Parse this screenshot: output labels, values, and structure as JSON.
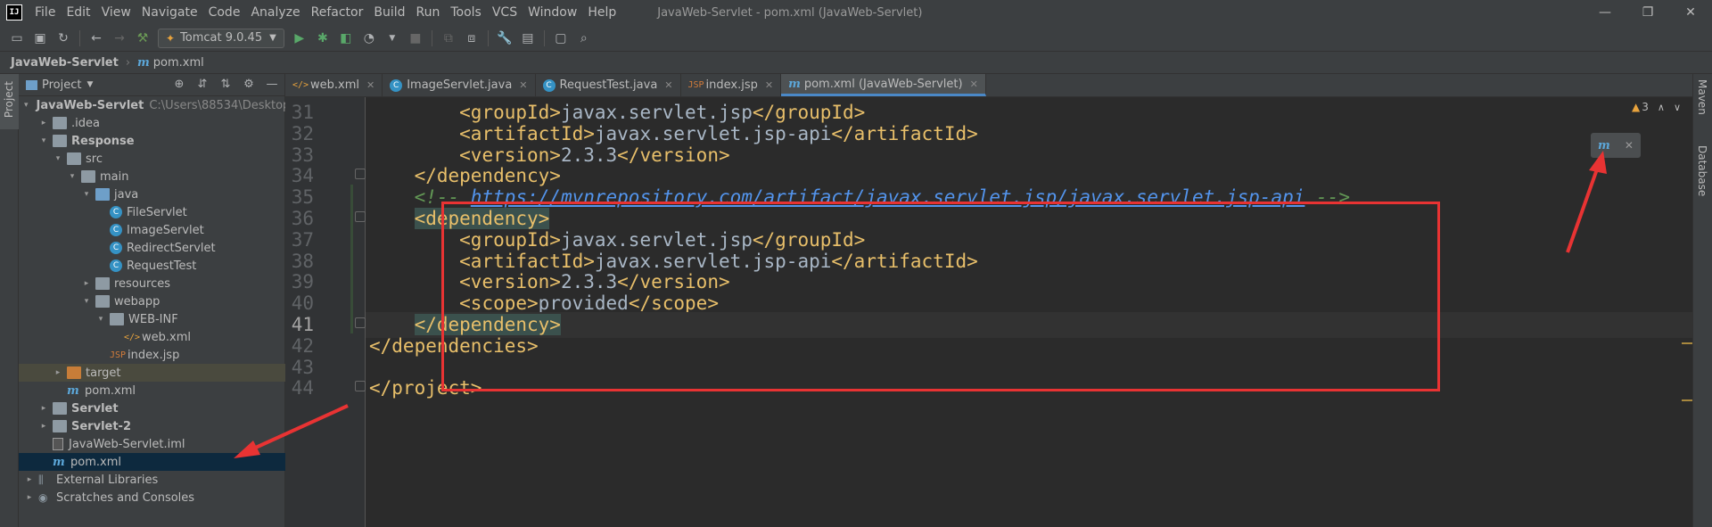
{
  "menubar": {
    "logo": "IJ",
    "items": [
      "File",
      "Edit",
      "View",
      "Navigate",
      "Code",
      "Analyze",
      "Refactor",
      "Build",
      "Run",
      "Tools",
      "VCS",
      "Window",
      "Help"
    ],
    "window_title": "JavaWeb-Servlet - pom.xml (JavaWeb-Servlet)",
    "controls": [
      "—",
      "❐",
      "✕"
    ]
  },
  "toolbar": {
    "run_config": "Tomcat 9.0.45"
  },
  "breadcrumb": {
    "root": "JavaWeb-Servlet",
    "file": "pom.xml",
    "file_icon": "m"
  },
  "left_strip": {
    "project_label": "Project"
  },
  "project_panel": {
    "title": "Project",
    "tree": [
      {
        "label": "JavaWeb-Servlet",
        "path": "C:\\Users\\88534\\Desktop\\",
        "icon": "folder",
        "indent": 0,
        "expand": "▾",
        "bold": true
      },
      {
        "label": ".idea",
        "icon": "folder",
        "indent": 1,
        "expand": "▸"
      },
      {
        "label": "Response",
        "icon": "folder",
        "indent": 1,
        "expand": "▾",
        "bold": true
      },
      {
        "label": "src",
        "icon": "folder",
        "indent": 2,
        "expand": "▾"
      },
      {
        "label": "main",
        "icon": "folder",
        "indent": 3,
        "expand": "▾"
      },
      {
        "label": "java",
        "icon": "folder-blue",
        "indent": 4,
        "expand": "▾"
      },
      {
        "label": "FileServlet",
        "icon": "class",
        "indent": 5,
        "expand": ""
      },
      {
        "label": "ImageServlet",
        "icon": "class",
        "indent": 5,
        "expand": ""
      },
      {
        "label": "RedirectServlet",
        "icon": "class",
        "indent": 5,
        "expand": ""
      },
      {
        "label": "RequestTest",
        "icon": "class",
        "indent": 5,
        "expand": ""
      },
      {
        "label": "resources",
        "icon": "folder",
        "indent": 4,
        "expand": "▸"
      },
      {
        "label": "webapp",
        "icon": "folder",
        "indent": 4,
        "expand": "▾"
      },
      {
        "label": "WEB-INF",
        "icon": "folder",
        "indent": 5,
        "expand": "▾"
      },
      {
        "label": "web.xml",
        "icon": "xml",
        "indent": 6,
        "expand": ""
      },
      {
        "label": "index.jsp",
        "icon": "jsp",
        "indent": 5,
        "expand": ""
      },
      {
        "label": "target",
        "icon": "folder-orange",
        "indent": 2,
        "expand": "▸",
        "excluded": true
      },
      {
        "label": "pom.xml",
        "icon": "maven",
        "indent": 2,
        "expand": ""
      },
      {
        "label": "Servlet",
        "icon": "folder",
        "indent": 1,
        "expand": "▸",
        "bold": true
      },
      {
        "label": "Servlet-2",
        "icon": "folder",
        "indent": 1,
        "expand": "▸",
        "bold": true
      },
      {
        "label": "JavaWeb-Servlet.iml",
        "icon": "iml",
        "indent": 1,
        "expand": ""
      },
      {
        "label": "pom.xml",
        "icon": "maven",
        "indent": 1,
        "expand": "",
        "selected": true
      },
      {
        "label": "External Libraries",
        "icon": "lib",
        "indent": 0,
        "expand": "▸"
      },
      {
        "label": "Scratches and Consoles",
        "icon": "scratch",
        "indent": 0,
        "expand": "▸"
      }
    ]
  },
  "editor_tabs": [
    {
      "label": "web.xml",
      "icon": "xml"
    },
    {
      "label": "ImageServlet.java",
      "icon": "class"
    },
    {
      "label": "RequestTest.java",
      "icon": "class"
    },
    {
      "label": "index.jsp",
      "icon": "jsp"
    },
    {
      "label": "pom.xml (JavaWeb-Servlet)",
      "icon": "maven",
      "active": true
    }
  ],
  "editor": {
    "lines": [
      {
        "n": "31",
        "segs": [
          [
            "pad",
            "        "
          ],
          [
            "tag",
            "<groupId>"
          ],
          [
            "text",
            "javax.servlet.jsp"
          ],
          [
            "tag",
            "</groupId>"
          ]
        ]
      },
      {
        "n": "32",
        "segs": [
          [
            "pad",
            "        "
          ],
          [
            "tag",
            "<artifactId>"
          ],
          [
            "text",
            "javax.servlet.jsp-api"
          ],
          [
            "tag",
            "</artifactId>"
          ]
        ]
      },
      {
        "n": "33",
        "segs": [
          [
            "pad",
            "        "
          ],
          [
            "tag",
            "<version>"
          ],
          [
            "text",
            "2.3.3"
          ],
          [
            "tag",
            "</version>"
          ]
        ]
      },
      {
        "n": "34",
        "segs": [
          [
            "pad",
            "    "
          ],
          [
            "tag",
            "</dependency>"
          ]
        ]
      },
      {
        "n": "35",
        "segs": [
          [
            "pad",
            "    "
          ],
          [
            "comment",
            "<!-- "
          ],
          [
            "link",
            "https://mvnrepository.com/artifact/javax.servlet.jsp/javax.servlet.jsp-api"
          ],
          [
            "comment",
            " -->"
          ]
        ]
      },
      {
        "n": "36",
        "segs": [
          [
            "pad",
            "    "
          ],
          [
            "match",
            "<dependency>"
          ]
        ]
      },
      {
        "n": "37",
        "segs": [
          [
            "pad",
            "        "
          ],
          [
            "tag",
            "<groupId>"
          ],
          [
            "text",
            "javax.servlet.jsp"
          ],
          [
            "tag",
            "</groupId>"
          ]
        ]
      },
      {
        "n": "38",
        "segs": [
          [
            "pad",
            "        "
          ],
          [
            "tag",
            "<artifactId>"
          ],
          [
            "text",
            "javax.servlet.jsp-api"
          ],
          [
            "tag",
            "</artifactId>"
          ]
        ]
      },
      {
        "n": "39",
        "segs": [
          [
            "pad",
            "        "
          ],
          [
            "tag",
            "<version>"
          ],
          [
            "text",
            "2.3.3"
          ],
          [
            "tag",
            "</version>"
          ]
        ]
      },
      {
        "n": "40",
        "segs": [
          [
            "pad",
            "        "
          ],
          [
            "tag",
            "<scope>"
          ],
          [
            "text",
            "provided"
          ],
          [
            "tag",
            "</scope>"
          ]
        ]
      },
      {
        "n": "41",
        "segs": [
          [
            "pad",
            "    "
          ],
          [
            "match",
            "</dependency>"
          ]
        ],
        "current": true
      },
      {
        "n": "42",
        "segs": [
          [
            "pad",
            ""
          ],
          [
            "tag",
            "</dependencies>"
          ]
        ]
      },
      {
        "n": "43",
        "segs": []
      },
      {
        "n": "44",
        "segs": [
          [
            "tag",
            "</project>"
          ]
        ]
      }
    ]
  },
  "inspection": {
    "warnings": "3"
  },
  "right_strip": {
    "maven_label": "Maven",
    "database_label": "Database"
  },
  "maven_popup": {
    "icon": "m",
    "close": "✕"
  },
  "colors": {
    "highlight": "#e83333",
    "tag": "#e8bf6a",
    "comment": "#629755",
    "link": "#5394ec"
  }
}
